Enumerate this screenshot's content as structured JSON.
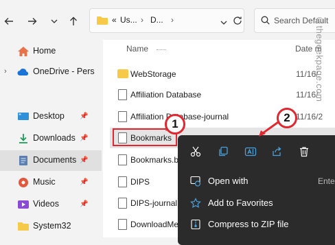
{
  "nav": {
    "back_icon": "arrow-left-icon",
    "forward_icon": "arrow-right-icon",
    "history_icon": "chevron-down-icon",
    "up_icon": "arrow-up-icon"
  },
  "address": {
    "ellipsis": "«",
    "seg1": "Us...",
    "seg2": "D..."
  },
  "search": {
    "placeholder": "Search Default"
  },
  "sidebar": {
    "items": [
      {
        "label": "Home",
        "icon": "home-icon"
      },
      {
        "label": "OneDrive - Perso",
        "icon": "cloud-icon"
      },
      {
        "label": "Desktop",
        "icon": "desktop-icon",
        "pinned": true
      },
      {
        "label": "Downloads",
        "icon": "download-icon",
        "pinned": true
      },
      {
        "label": "Documents",
        "icon": "documents-icon",
        "pinned": true,
        "selected": true
      },
      {
        "label": "Music",
        "icon": "music-icon",
        "pinned": true
      },
      {
        "label": "Videos",
        "icon": "video-icon",
        "pinned": true
      },
      {
        "label": "System32",
        "icon": "folder-icon"
      }
    ]
  },
  "columns": {
    "name": "Name",
    "date": "Date m"
  },
  "files": [
    {
      "name": "WebStorage",
      "date": "11/16/",
      "type": "folder"
    },
    {
      "name": "Affiliation Database",
      "date": "11/16/",
      "type": "file"
    },
    {
      "name": "Affiliation Database-journal",
      "date": "11/16/2",
      "type": "file"
    },
    {
      "name": "Bookmarks",
      "date": "",
      "type": "file"
    },
    {
      "name": "Bookmarks.bak",
      "date": "",
      "type": "file"
    },
    {
      "name": "DIPS",
      "date": "",
      "type": "file"
    },
    {
      "name": "DIPS-journal",
      "date": "",
      "type": "file"
    },
    {
      "name": "DownloadMetadata",
      "date": "",
      "type": "file"
    }
  ],
  "context_menu": {
    "toolbar": [
      "cut-icon",
      "copy-icon",
      "rename-icon",
      "share-icon",
      "delete-icon"
    ],
    "items": [
      {
        "label": "Open with",
        "extra": "Enter",
        "icon": "open-with-icon"
      },
      {
        "label": "Add to Favorites",
        "icon": "star-icon"
      },
      {
        "label": "Compress to ZIP file",
        "icon": "zip-icon"
      }
    ]
  },
  "annotations": {
    "badge1": "1",
    "badge2": "2"
  },
  "watermark": "©thegeekpage.com",
  "colors": {
    "accent_red": "#e0262e",
    "menu_bg": "#2b2b2b",
    "icon_blue": "#4aa3df"
  }
}
